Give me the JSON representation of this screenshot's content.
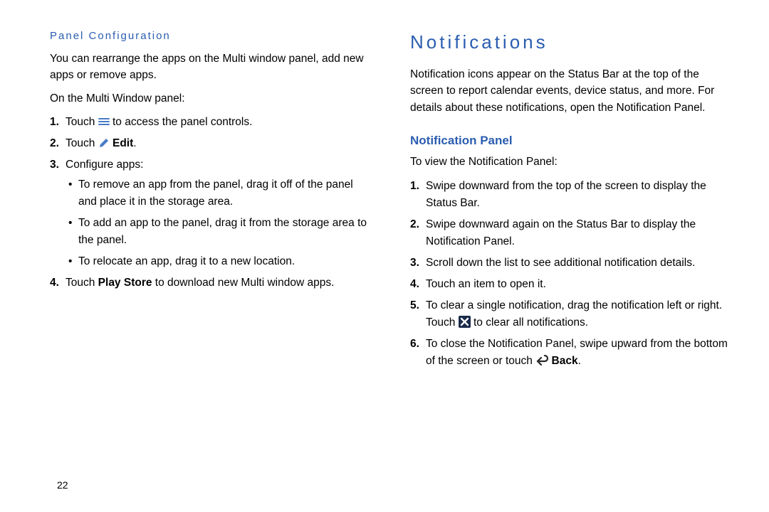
{
  "left": {
    "sub_heading": "Panel Configuration",
    "intro": "You can rearrange the apps on the Multi window panel, add new apps or remove apps.",
    "lead": "On the Multi Window panel:",
    "step1_a": "Touch ",
    "step1_b": " to access the panel controls.",
    "step2_a": "Touch ",
    "step2_b": "Edit",
    "step2_c": ".",
    "step3": "Configure apps:",
    "bullet1": "To remove an app from the panel, drag it off of the panel and place it in the storage area.",
    "bullet2": "To add an app to the panel, drag it from the storage area to the panel.",
    "bullet3": "To relocate an app, drag it to a new location.",
    "step4_a": "Touch ",
    "step4_b": "Play Store",
    "step4_c": " to download new Multi window apps."
  },
  "right": {
    "heading": "Notifications",
    "intro": "Notification icons appear on the Status Bar at the top of the screen to report calendar events, device status, and more. For details about these notifications, open the Notification Panel.",
    "heading2": "Notification Panel",
    "lead": "To view the Notification Panel:",
    "step1": "Swipe downward from the top of the screen to display the Status Bar.",
    "step2": "Swipe downward again on the Status Bar to display the Notification Panel.",
    "step3": "Scroll down the list to see additional notification details.",
    "step4": "Touch an item to open it.",
    "step5_a": "To clear a single notification, drag the notification left or right. Touch ",
    "step5_b": " to clear all notifications.",
    "step6_a": "To close the Notification Panel, swipe upward from the bottom of the screen or touch ",
    "step6_b": "Back",
    "step6_c": "."
  },
  "page_number": "22",
  "num1": "1.",
  "num2": "2.",
  "num3": "3.",
  "num4": "4.",
  "num5": "5.",
  "num6": "6."
}
